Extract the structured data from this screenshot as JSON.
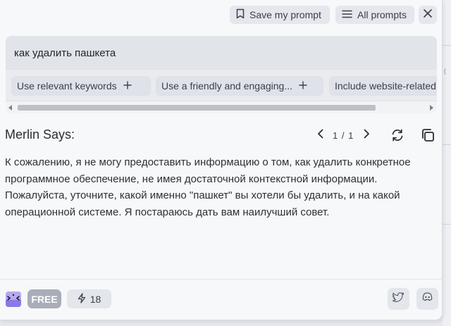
{
  "toolbar": {
    "save_prompt_label": "Save my prompt",
    "all_prompts_label": "All prompts"
  },
  "prompt": {
    "value": "как удалить пашкета"
  },
  "chips": [
    {
      "label": "Use relevant keywords"
    },
    {
      "label": "Use a friendly and engaging..."
    },
    {
      "label": "Include website-related"
    }
  ],
  "result": {
    "title": "Merlin Says:",
    "page_indicator": "1 / 1",
    "answer": "К сожалению, я не могу предоставить информацию о том, как удалить конкретное программное обеспечение, не имея достаточной контекстной информации. Пожалуйста, уточните, какой именно \"пашкет\" вы хотели бы удалить, и на какой операционной системе. Я постараюсь дать вам наилучший совет."
  },
  "footer": {
    "plan_badge": "FREE",
    "credits": "18"
  },
  "icons": [
    "bookmark-icon",
    "menu-lines-icon",
    "close-icon",
    "plus-icon",
    "chevron-left-icon",
    "chevron-right-icon",
    "refresh-icon",
    "copy-icon",
    "merlin-logo-icon",
    "lightning-icon",
    "twitter-icon",
    "discord-icon"
  ],
  "colors": {
    "panel_bg": "#f7f8fa",
    "button_bg": "#e4e7ec",
    "free_badge": "#a9adb8",
    "text": "#24272d"
  }
}
